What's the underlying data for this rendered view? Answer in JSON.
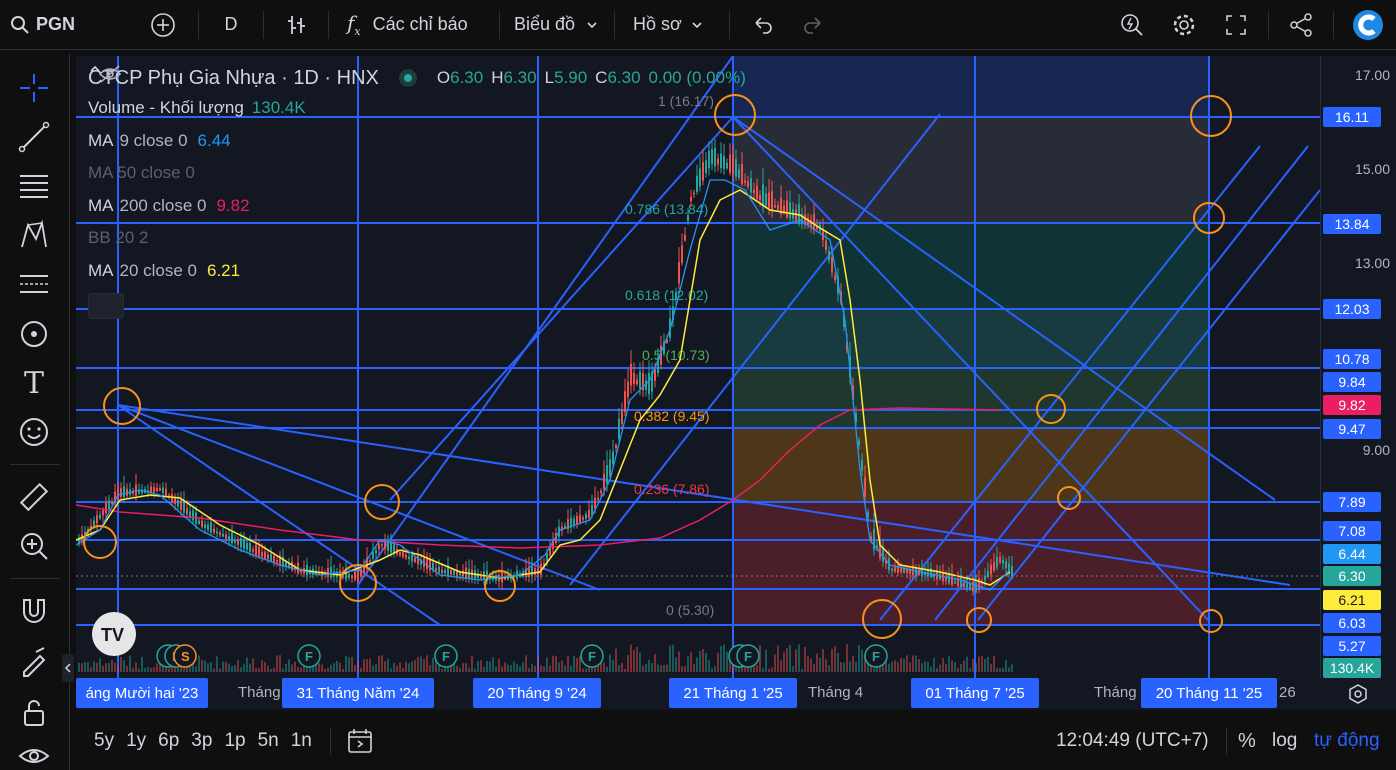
{
  "topbar": {
    "symbol": "PGN",
    "interval": "D",
    "indicators_label": "Các chỉ báo",
    "chart_type_label": "Biểu đồ",
    "profile_label": "Hồ sơ"
  },
  "legend": {
    "title": "CTCP Phụ Gia Nhựa · 1D · HNX",
    "open_label": "O",
    "open": "6.30",
    "high_label": "H",
    "high": "6.30",
    "low_label": "L",
    "low": "5.90",
    "close_label": "C",
    "close": "6.30",
    "change": "0.00 (0.00%)",
    "volume_label": "Volume - Khối lượng",
    "volume_value": "130.4K",
    "ma9_label": "MA",
    "ma9_params": "9 close 0",
    "ma9_value": "6.44",
    "ma50_label": "MA 50 close 0",
    "ma200_label": "MA",
    "ma200_params": "200 close 0",
    "ma200_value": "9.82",
    "bb_label": "BB 20 2",
    "ma20_label": "MA",
    "ma20_params": "20 close 0",
    "ma20_value": "6.21"
  },
  "fib": {
    "l1": "1 (16.17)",
    "l0786": "0.786 (13.84)",
    "l0618": "0.618 (12.02)",
    "l05": "0.5 (10.73)",
    "l0382": "0.382 (9.45)",
    "l0236": "0.236 (7.86)",
    "l0": "0 (5.30)"
  },
  "price_axis": {
    "ticks": [
      "17.00",
      "15.00",
      "13.00",
      "9.00"
    ],
    "badges": {
      "b1611": "16.11",
      "b1384": "13.84",
      "b1203": "12.03",
      "b1078": "10.78",
      "b984": "9.84",
      "b982": "9.82",
      "b947": "9.47",
      "b789": "7.89",
      "b708": "7.08",
      "b644": "6.44",
      "b630": "6.30",
      "b621": "6.21",
      "b603": "6.03",
      "b527": "5.27",
      "bvol": "130.4K"
    }
  },
  "time_axis": {
    "t1": "áng Mười hai '23",
    "t2": "Tháng",
    "t3": "31 Tháng Năm '24",
    "t4": "20 Tháng 9 '24",
    "t5": "21 Tháng 1 '25",
    "t6": "Tháng 4",
    "t7": "01 Tháng 7 '25",
    "t8": "Tháng",
    "t9": "20 Tháng 11 '25",
    "t10": "26"
  },
  "events": {
    "f": "F",
    "s": "S"
  },
  "bottombar": {
    "ranges": [
      "5y",
      "1y",
      "6p",
      "3p",
      "1p",
      "5n",
      "1n"
    ],
    "clock": "12:04:49 (UTC+7)",
    "percent": "%",
    "log": "log",
    "auto": "tự động"
  },
  "colors": {
    "background": "#131722",
    "blue_line": "#2962ff",
    "orange_circle": "#f7931a",
    "ma9": "#2196f3",
    "ma20": "#ffeb3b",
    "ma200": "#e91e63",
    "up": "#26a69a",
    "down": "#ef5350"
  },
  "icons": {
    "search": "search-icon",
    "add": "plus-circle-icon",
    "bars": "bar-chart-icon",
    "fx": "function-icon",
    "undo": "undo-icon",
    "redo": "redo-icon",
    "alert": "alert-icon",
    "settings": "gear-icon",
    "fullscreen": "fullscreen-icon",
    "share": "share-icon",
    "logo": "brand-logo"
  }
}
